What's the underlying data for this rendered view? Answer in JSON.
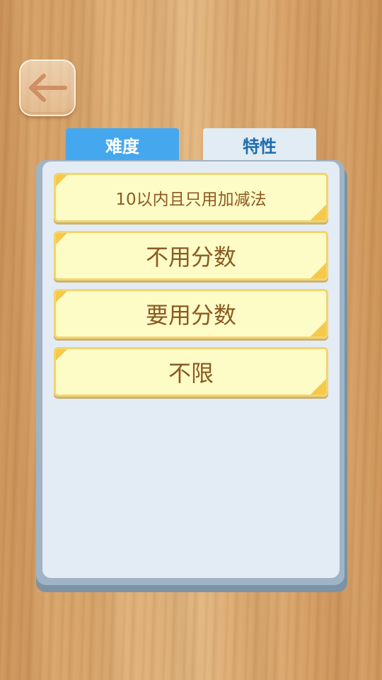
{
  "header": {
    "back_icon": "arrow-left-icon"
  },
  "tabs": [
    {
      "label": "难度",
      "active": true
    },
    {
      "label": "特性",
      "active": false
    }
  ],
  "options": [
    {
      "label": "10以内且只用加减法"
    },
    {
      "label": "不用分数"
    },
    {
      "label": "要用分数"
    },
    {
      "label": "不限"
    }
  ],
  "colors": {
    "tab_active": "#45a8ef",
    "tab_inactive": "#e1ecf5",
    "option_fill": "#fdfbc6",
    "option_border": "#f4d46b",
    "option_text": "#8a5a22",
    "panel": "#e3ecf5"
  }
}
